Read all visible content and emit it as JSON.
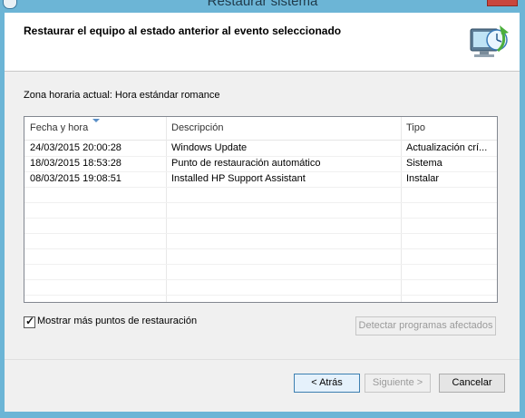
{
  "window": {
    "title": "Restaurar sistema"
  },
  "header": {
    "title": "Restaurar el equipo al estado anterior al evento seleccionado"
  },
  "timezone": "Zona horaria actual: Hora estándar romance",
  "list": {
    "columns": [
      "Fecha y hora",
      "Descripción",
      "Tipo"
    ],
    "rows": [
      {
        "date": "24/03/2015 20:00:28",
        "description": "Windows Update",
        "type": "Actualización crí..."
      },
      {
        "date": "18/03/2015 18:53:28",
        "description": "Punto de restauración automático",
        "type": "Sistema"
      },
      {
        "date": "08/03/2015 19:08:51",
        "description": "Installed HP Support Assistant",
        "type": "Instalar"
      }
    ]
  },
  "show_more": {
    "label": "Mostrar más puntos de restauración",
    "checked": true
  },
  "buttons": {
    "detect": "Detectar programas afectados",
    "back": "< Atrás",
    "next": "Siguiente >",
    "cancel": "Cancelar"
  },
  "colors": {
    "frame": "#6cb5d6",
    "close": "#c9463d",
    "sort_arrow": "#5a8fc7"
  }
}
